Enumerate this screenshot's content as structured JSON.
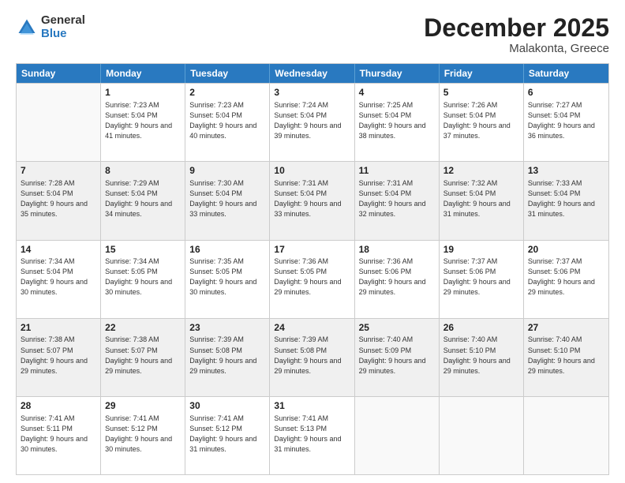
{
  "logo": {
    "general": "General",
    "blue": "Blue"
  },
  "title": "December 2025",
  "subtitle": "Malakonta, Greece",
  "header_days": [
    "Sunday",
    "Monday",
    "Tuesday",
    "Wednesday",
    "Thursday",
    "Friday",
    "Saturday"
  ],
  "weeks": [
    [
      {
        "day": "",
        "sunrise": "",
        "sunset": "",
        "daylight": "",
        "shaded": false,
        "empty": true
      },
      {
        "day": "1",
        "sunrise": "Sunrise: 7:23 AM",
        "sunset": "Sunset: 5:04 PM",
        "daylight": "Daylight: 9 hours and 41 minutes.",
        "shaded": false
      },
      {
        "day": "2",
        "sunrise": "Sunrise: 7:23 AM",
        "sunset": "Sunset: 5:04 PM",
        "daylight": "Daylight: 9 hours and 40 minutes.",
        "shaded": false
      },
      {
        "day": "3",
        "sunrise": "Sunrise: 7:24 AM",
        "sunset": "Sunset: 5:04 PM",
        "daylight": "Daylight: 9 hours and 39 minutes.",
        "shaded": false
      },
      {
        "day": "4",
        "sunrise": "Sunrise: 7:25 AM",
        "sunset": "Sunset: 5:04 PM",
        "daylight": "Daylight: 9 hours and 38 minutes.",
        "shaded": false
      },
      {
        "day": "5",
        "sunrise": "Sunrise: 7:26 AM",
        "sunset": "Sunset: 5:04 PM",
        "daylight": "Daylight: 9 hours and 37 minutes.",
        "shaded": false
      },
      {
        "day": "6",
        "sunrise": "Sunrise: 7:27 AM",
        "sunset": "Sunset: 5:04 PM",
        "daylight": "Daylight: 9 hours and 36 minutes.",
        "shaded": false
      }
    ],
    [
      {
        "day": "7",
        "sunrise": "Sunrise: 7:28 AM",
        "sunset": "Sunset: 5:04 PM",
        "daylight": "Daylight: 9 hours and 35 minutes.",
        "shaded": true
      },
      {
        "day": "8",
        "sunrise": "Sunrise: 7:29 AM",
        "sunset": "Sunset: 5:04 PM",
        "daylight": "Daylight: 9 hours and 34 minutes.",
        "shaded": true
      },
      {
        "day": "9",
        "sunrise": "Sunrise: 7:30 AM",
        "sunset": "Sunset: 5:04 PM",
        "daylight": "Daylight: 9 hours and 33 minutes.",
        "shaded": true
      },
      {
        "day": "10",
        "sunrise": "Sunrise: 7:31 AM",
        "sunset": "Sunset: 5:04 PM",
        "daylight": "Daylight: 9 hours and 33 minutes.",
        "shaded": true
      },
      {
        "day": "11",
        "sunrise": "Sunrise: 7:31 AM",
        "sunset": "Sunset: 5:04 PM",
        "daylight": "Daylight: 9 hours and 32 minutes.",
        "shaded": true
      },
      {
        "day": "12",
        "sunrise": "Sunrise: 7:32 AM",
        "sunset": "Sunset: 5:04 PM",
        "daylight": "Daylight: 9 hours and 31 minutes.",
        "shaded": true
      },
      {
        "day": "13",
        "sunrise": "Sunrise: 7:33 AM",
        "sunset": "Sunset: 5:04 PM",
        "daylight": "Daylight: 9 hours and 31 minutes.",
        "shaded": true
      }
    ],
    [
      {
        "day": "14",
        "sunrise": "Sunrise: 7:34 AM",
        "sunset": "Sunset: 5:04 PM",
        "daylight": "Daylight: 9 hours and 30 minutes.",
        "shaded": false
      },
      {
        "day": "15",
        "sunrise": "Sunrise: 7:34 AM",
        "sunset": "Sunset: 5:05 PM",
        "daylight": "Daylight: 9 hours and 30 minutes.",
        "shaded": false
      },
      {
        "day": "16",
        "sunrise": "Sunrise: 7:35 AM",
        "sunset": "Sunset: 5:05 PM",
        "daylight": "Daylight: 9 hours and 30 minutes.",
        "shaded": false
      },
      {
        "day": "17",
        "sunrise": "Sunrise: 7:36 AM",
        "sunset": "Sunset: 5:05 PM",
        "daylight": "Daylight: 9 hours and 29 minutes.",
        "shaded": false
      },
      {
        "day": "18",
        "sunrise": "Sunrise: 7:36 AM",
        "sunset": "Sunset: 5:06 PM",
        "daylight": "Daylight: 9 hours and 29 minutes.",
        "shaded": false
      },
      {
        "day": "19",
        "sunrise": "Sunrise: 7:37 AM",
        "sunset": "Sunset: 5:06 PM",
        "daylight": "Daylight: 9 hours and 29 minutes.",
        "shaded": false
      },
      {
        "day": "20",
        "sunrise": "Sunrise: 7:37 AM",
        "sunset": "Sunset: 5:06 PM",
        "daylight": "Daylight: 9 hours and 29 minutes.",
        "shaded": false
      }
    ],
    [
      {
        "day": "21",
        "sunrise": "Sunrise: 7:38 AM",
        "sunset": "Sunset: 5:07 PM",
        "daylight": "Daylight: 9 hours and 29 minutes.",
        "shaded": true
      },
      {
        "day": "22",
        "sunrise": "Sunrise: 7:38 AM",
        "sunset": "Sunset: 5:07 PM",
        "daylight": "Daylight: 9 hours and 29 minutes.",
        "shaded": true
      },
      {
        "day": "23",
        "sunrise": "Sunrise: 7:39 AM",
        "sunset": "Sunset: 5:08 PM",
        "daylight": "Daylight: 9 hours and 29 minutes.",
        "shaded": true
      },
      {
        "day": "24",
        "sunrise": "Sunrise: 7:39 AM",
        "sunset": "Sunset: 5:08 PM",
        "daylight": "Daylight: 9 hours and 29 minutes.",
        "shaded": true
      },
      {
        "day": "25",
        "sunrise": "Sunrise: 7:40 AM",
        "sunset": "Sunset: 5:09 PM",
        "daylight": "Daylight: 9 hours and 29 minutes.",
        "shaded": true
      },
      {
        "day": "26",
        "sunrise": "Sunrise: 7:40 AM",
        "sunset": "Sunset: 5:10 PM",
        "daylight": "Daylight: 9 hours and 29 minutes.",
        "shaded": true
      },
      {
        "day": "27",
        "sunrise": "Sunrise: 7:40 AM",
        "sunset": "Sunset: 5:10 PM",
        "daylight": "Daylight: 9 hours and 29 minutes.",
        "shaded": true
      }
    ],
    [
      {
        "day": "28",
        "sunrise": "Sunrise: 7:41 AM",
        "sunset": "Sunset: 5:11 PM",
        "daylight": "Daylight: 9 hours and 30 minutes.",
        "shaded": false
      },
      {
        "day": "29",
        "sunrise": "Sunrise: 7:41 AM",
        "sunset": "Sunset: 5:12 PM",
        "daylight": "Daylight: 9 hours and 30 minutes.",
        "shaded": false
      },
      {
        "day": "30",
        "sunrise": "Sunrise: 7:41 AM",
        "sunset": "Sunset: 5:12 PM",
        "daylight": "Daylight: 9 hours and 31 minutes.",
        "shaded": false
      },
      {
        "day": "31",
        "sunrise": "Sunrise: 7:41 AM",
        "sunset": "Sunset: 5:13 PM",
        "daylight": "Daylight: 9 hours and 31 minutes.",
        "shaded": false
      },
      {
        "day": "",
        "sunrise": "",
        "sunset": "",
        "daylight": "",
        "shaded": false,
        "empty": true
      },
      {
        "day": "",
        "sunrise": "",
        "sunset": "",
        "daylight": "",
        "shaded": false,
        "empty": true
      },
      {
        "day": "",
        "sunrise": "",
        "sunset": "",
        "daylight": "",
        "shaded": false,
        "empty": true
      }
    ]
  ]
}
